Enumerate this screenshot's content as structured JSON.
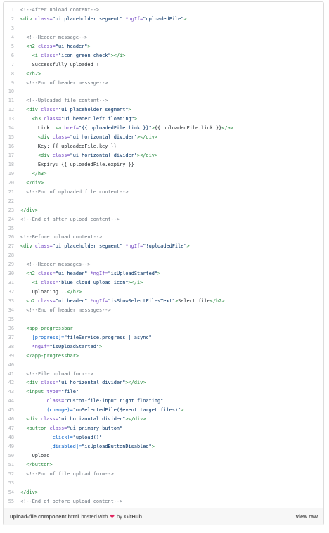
{
  "lines": [
    {
      "n": "1",
      "parts": [
        {
          "t": "<!--After upload content-->",
          "c": "com"
        }
      ]
    },
    {
      "n": "2",
      "parts": [
        {
          "t": "<div ",
          "c": "tag"
        },
        {
          "t": "class=",
          "c": "attr"
        },
        {
          "t": "\"ui placeholder segment\" ",
          "c": "str"
        },
        {
          "t": "*ngIf=",
          "c": "attr"
        },
        {
          "t": "\"uploadedFile\"",
          "c": "str"
        },
        {
          "t": ">",
          "c": "tag"
        }
      ]
    },
    {
      "n": "3",
      "parts": []
    },
    {
      "n": "4",
      "parts": [
        {
          "t": "  <!--Header message-->",
          "c": "com"
        }
      ]
    },
    {
      "n": "5",
      "parts": [
        {
          "t": "  <h2 ",
          "c": "tag"
        },
        {
          "t": "class=",
          "c": "attr"
        },
        {
          "t": "\"ui header\"",
          "c": "str"
        },
        {
          "t": ">",
          "c": "tag"
        }
      ]
    },
    {
      "n": "6",
      "parts": [
        {
          "t": "    <i ",
          "c": "tag"
        },
        {
          "t": "class=",
          "c": "attr"
        },
        {
          "t": "\"icon green check\"",
          "c": "str"
        },
        {
          "t": "></i>",
          "c": "tag"
        }
      ]
    },
    {
      "n": "7",
      "parts": [
        {
          "t": "    Successfully uploaded !",
          "c": ""
        }
      ]
    },
    {
      "n": "8",
      "parts": [
        {
          "t": "  </h2>",
          "c": "tag"
        }
      ]
    },
    {
      "n": "9",
      "parts": [
        {
          "t": "  <!--End of header message-->",
          "c": "com"
        }
      ]
    },
    {
      "n": "10",
      "parts": []
    },
    {
      "n": "11",
      "parts": [
        {
          "t": "  <!--Uploaded file content-->",
          "c": "com"
        }
      ]
    },
    {
      "n": "12",
      "parts": [
        {
          "t": "  <div ",
          "c": "tag"
        },
        {
          "t": "class=",
          "c": "attr"
        },
        {
          "t": "\"ui placeholder segment\"",
          "c": "str"
        },
        {
          "t": ">",
          "c": "tag"
        }
      ]
    },
    {
      "n": "13",
      "parts": [
        {
          "t": "    <h3 ",
          "c": "tag"
        },
        {
          "t": "class=",
          "c": "attr"
        },
        {
          "t": "\"ui header left floating\"",
          "c": "str"
        },
        {
          "t": ">",
          "c": "tag"
        }
      ]
    },
    {
      "n": "14",
      "parts": [
        {
          "t": "      Link: ",
          "c": ""
        },
        {
          "t": "<a ",
          "c": "tag"
        },
        {
          "t": "href=",
          "c": "attr"
        },
        {
          "t": "\"{{ uploadedFile.link }}\"",
          "c": "str"
        },
        {
          "t": ">",
          "c": "tag"
        },
        {
          "t": "{{ uploadedFile.link }}",
          "c": ""
        },
        {
          "t": "</a>",
          "c": "tag"
        }
      ]
    },
    {
      "n": "15",
      "parts": [
        {
          "t": "      <div ",
          "c": "tag"
        },
        {
          "t": "class=",
          "c": "attr"
        },
        {
          "t": "\"ui horizontal divider\"",
          "c": "str"
        },
        {
          "t": "></div>",
          "c": "tag"
        }
      ]
    },
    {
      "n": "16",
      "parts": [
        {
          "t": "      Key: {{ uploadedFile.key }}",
          "c": ""
        }
      ]
    },
    {
      "n": "17",
      "parts": [
        {
          "t": "      <div ",
          "c": "tag"
        },
        {
          "t": "class=",
          "c": "attr"
        },
        {
          "t": "\"ui horizontal divider\"",
          "c": "str"
        },
        {
          "t": "></div>",
          "c": "tag"
        }
      ]
    },
    {
      "n": "18",
      "parts": [
        {
          "t": "      Expiry: {{ uploadedFile.expiry }}",
          "c": ""
        }
      ]
    },
    {
      "n": "19",
      "parts": [
        {
          "t": "    </h3>",
          "c": "tag"
        }
      ]
    },
    {
      "n": "20",
      "parts": [
        {
          "t": "  </div>",
          "c": "tag"
        }
      ]
    },
    {
      "n": "21",
      "parts": [
        {
          "t": "  <!--End of uploaded file content-->",
          "c": "com"
        }
      ]
    },
    {
      "n": "22",
      "parts": []
    },
    {
      "n": "23",
      "parts": [
        {
          "t": "</div>",
          "c": "tag"
        }
      ]
    },
    {
      "n": "24",
      "parts": [
        {
          "t": "<!--End of after upload content-->",
          "c": "com"
        }
      ]
    },
    {
      "n": "25",
      "parts": []
    },
    {
      "n": "26",
      "parts": [
        {
          "t": "<!--Before upload content-->",
          "c": "com"
        }
      ]
    },
    {
      "n": "27",
      "parts": [
        {
          "t": "<div ",
          "c": "tag"
        },
        {
          "t": "class=",
          "c": "attr"
        },
        {
          "t": "\"ui placeholder segment\" ",
          "c": "str"
        },
        {
          "t": "*ngIf=",
          "c": "attr"
        },
        {
          "t": "\"!uploadedFile\"",
          "c": "str"
        },
        {
          "t": ">",
          "c": "tag"
        }
      ]
    },
    {
      "n": "28",
      "parts": []
    },
    {
      "n": "29",
      "parts": [
        {
          "t": "  <!--Header messages-->",
          "c": "com"
        }
      ]
    },
    {
      "n": "30",
      "parts": [
        {
          "t": "  <h2 ",
          "c": "tag"
        },
        {
          "t": "class=",
          "c": "attr"
        },
        {
          "t": "\"ui header\" ",
          "c": "str"
        },
        {
          "t": "*ngIf=",
          "c": "attr"
        },
        {
          "t": "\"isUploadStarted\"",
          "c": "str"
        },
        {
          "t": ">",
          "c": "tag"
        }
      ]
    },
    {
      "n": "31",
      "parts": [
        {
          "t": "    <i ",
          "c": "tag"
        },
        {
          "t": "class=",
          "c": "attr"
        },
        {
          "t": "\"blue cloud upload icon\"",
          "c": "str"
        },
        {
          "t": "></i>",
          "c": "tag"
        }
      ]
    },
    {
      "n": "32",
      "parts": [
        {
          "t": "    Uploading...",
          "c": ""
        },
        {
          "t": "</h2>",
          "c": "tag"
        }
      ]
    },
    {
      "n": "33",
      "parts": [
        {
          "t": "  <h2 ",
          "c": "tag"
        },
        {
          "t": "class=",
          "c": "attr"
        },
        {
          "t": "\"ui header\" ",
          "c": "str"
        },
        {
          "t": "*ngIf=",
          "c": "attr"
        },
        {
          "t": "\"isShowSelectFilesText\"",
          "c": "str"
        },
        {
          "t": ">",
          "c": "tag"
        },
        {
          "t": "Select file",
          "c": ""
        },
        {
          "t": "</h2>",
          "c": "tag"
        }
      ]
    },
    {
      "n": "34",
      "parts": [
        {
          "t": "  <!--End of header messages-->",
          "c": "com"
        }
      ]
    },
    {
      "n": "35",
      "parts": []
    },
    {
      "n": "36",
      "parts": [
        {
          "t": "  <app-progressbar",
          "c": "tag"
        }
      ]
    },
    {
      "n": "37",
      "parts": [
        {
          "t": "    [progress]=",
          "c": "ng"
        },
        {
          "t": "\"fileService.progress | async\"",
          "c": "str"
        }
      ]
    },
    {
      "n": "38",
      "parts": [
        {
          "t": "    *ngIf=",
          "c": "attr"
        },
        {
          "t": "\"isUploadStarted\"",
          "c": "str"
        },
        {
          "t": ">",
          "c": "tag"
        }
      ]
    },
    {
      "n": "39",
      "parts": [
        {
          "t": "  </app-progressbar>",
          "c": "tag"
        }
      ]
    },
    {
      "n": "40",
      "parts": []
    },
    {
      "n": "41",
      "parts": [
        {
          "t": "  <!--File upload form-->",
          "c": "com"
        }
      ]
    },
    {
      "n": "42",
      "parts": [
        {
          "t": "  <div ",
          "c": "tag"
        },
        {
          "t": "class=",
          "c": "attr"
        },
        {
          "t": "\"ui horizontal divider\"",
          "c": "str"
        },
        {
          "t": "></div>",
          "c": "tag"
        }
      ]
    },
    {
      "n": "43",
      "parts": [
        {
          "t": "  <input ",
          "c": "tag"
        },
        {
          "t": "type=",
          "c": "attr"
        },
        {
          "t": "\"file\"",
          "c": "str"
        }
      ]
    },
    {
      "n": "44",
      "parts": [
        {
          "t": "         class=",
          "c": "attr"
        },
        {
          "t": "\"custom-file-input right floating\"",
          "c": "str"
        }
      ]
    },
    {
      "n": "45",
      "parts": [
        {
          "t": "         (change)=",
          "c": "ng"
        },
        {
          "t": "\"onSelectedFile($event.target.files)\"",
          "c": "str"
        },
        {
          "t": ">",
          "c": "tag"
        }
      ]
    },
    {
      "n": "46",
      "parts": [
        {
          "t": "  <div ",
          "c": "tag"
        },
        {
          "t": "class=",
          "c": "attr"
        },
        {
          "t": "\"ui horizontal divider\"",
          "c": "str"
        },
        {
          "t": "></div>",
          "c": "tag"
        }
      ]
    },
    {
      "n": "47",
      "parts": [
        {
          "t": "  <button ",
          "c": "tag"
        },
        {
          "t": "class=",
          "c": "attr"
        },
        {
          "t": "\"ui primary button\"",
          "c": "str"
        }
      ]
    },
    {
      "n": "48",
      "parts": [
        {
          "t": "          (click)=",
          "c": "ng"
        },
        {
          "t": "\"upload()\"",
          "c": "str"
        }
      ]
    },
    {
      "n": "49",
      "parts": [
        {
          "t": "          [disabled]=",
          "c": "ng"
        },
        {
          "t": "\"isUploadButtonDisabled\"",
          "c": "str"
        },
        {
          "t": ">",
          "c": "tag"
        }
      ]
    },
    {
      "n": "50",
      "parts": [
        {
          "t": "    Upload",
          "c": ""
        }
      ]
    },
    {
      "n": "51",
      "parts": [
        {
          "t": "  </button>",
          "c": "tag"
        }
      ]
    },
    {
      "n": "52",
      "parts": [
        {
          "t": "  <!--End of file upload form-->",
          "c": "com"
        }
      ]
    },
    {
      "n": "53",
      "parts": []
    },
    {
      "n": "54",
      "parts": [
        {
          "t": "</div>",
          "c": "tag"
        }
      ]
    },
    {
      "n": "55",
      "parts": [
        {
          "t": "<!--End of before upload content-->",
          "c": "com"
        }
      ]
    }
  ],
  "footer": {
    "filename": "upload-file.component.html",
    "hosted_with": "hosted with",
    "by": "by",
    "github": "GitHub",
    "view_raw": "view raw",
    "heart_icon": "heart-icon",
    "heart_color": "#e0245e"
  }
}
